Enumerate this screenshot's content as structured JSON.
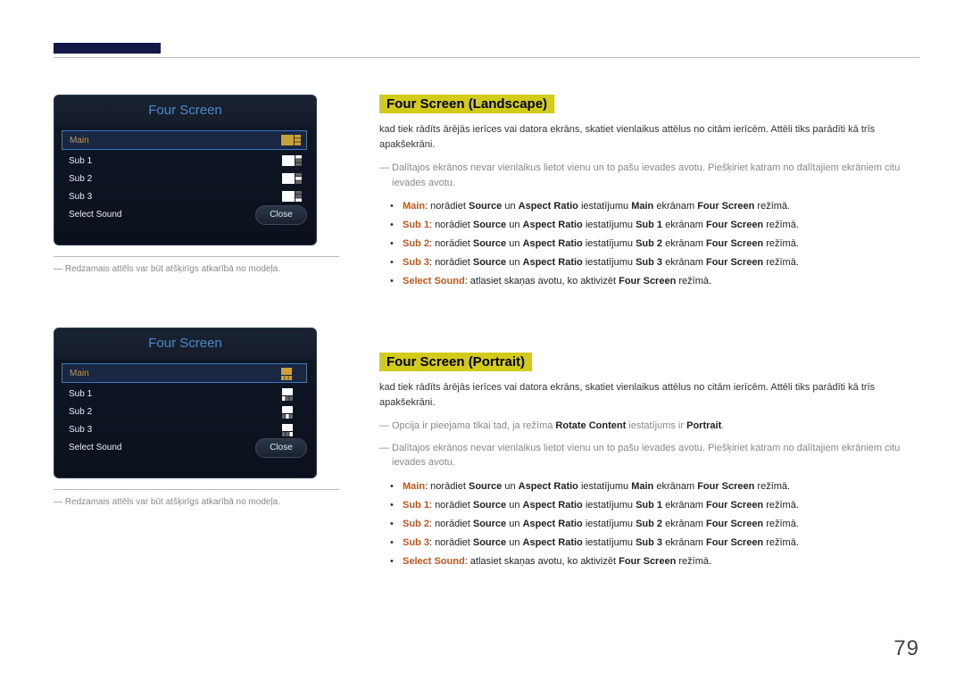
{
  "page_number": "79",
  "osd": {
    "title": "Four Screen",
    "rows": [
      "Main",
      "Sub 1",
      "Sub 2",
      "Sub 3",
      "Select Sound"
    ],
    "close": "Close"
  },
  "caption": "Redzamais attēls var būt atšķirīgs atkarībā no modeļa.",
  "landscape": {
    "title": "Four Screen (Landscape)",
    "lead": "kad tiek rādīts ārējās ierīces vai datora ekrāns, skatiet vienlaikus attēlus no citām ierīcēm. Attēli tiks parādīti kā trīs apakšekrāni.",
    "note1_prefix": "Dalītajos ekrānos nevar vienlaikus lietot vienu un to pašu ievades avotu. Piešķiriet katram no dalītajiem ekrāniem citu ievades avotu.",
    "items": [
      {
        "k": "Main",
        "mid": ": norādiet ",
        "a": "Source",
        "un": " un ",
        "b": "Aspect Ratio",
        "t1": " iestatījumu ",
        "c": "Main",
        "t2": " ekrānam ",
        "d": "Four Screen",
        "t3": " režīmā."
      },
      {
        "k": "Sub 1",
        "mid": ": norādiet ",
        "a": "Source",
        "un": " un ",
        "b": "Aspect Ratio",
        "t1": " iestatījumu ",
        "c": "Sub 1",
        "t2": " ekrānam ",
        "d": "Four Screen",
        "t3": " režīmā."
      },
      {
        "k": "Sub 2",
        "mid": ": norādiet ",
        "a": "Source",
        "un": " un ",
        "b": "Aspect Ratio",
        "t1": " iestatījumu ",
        "c": "Sub 2",
        "t2": " ekrānam ",
        "d": "Four Screen",
        "t3": " režīmā."
      },
      {
        "k": "Sub 3",
        "mid": ": norādiet ",
        "a": "Source",
        "un": " un ",
        "b": "Aspect Ratio",
        "t1": " iestatījumu ",
        "c": "Sub 3",
        "t2": " ekrānam ",
        "d": "Four Screen",
        "t3": " režīmā."
      },
      {
        "k": "Select Sound",
        "mid": ": atlasiet skaņas avotu, ko aktivizēt ",
        "a": "Four Screen",
        "t3": " režīmā."
      }
    ]
  },
  "portrait": {
    "title": "Four Screen (Portrait)",
    "lead": "kad tiek rādīts ārējās ierīces vai datora ekrāns, skatiet vienlaikus attēlus no citām ierīcēm. Attēli tiks parādīti kā trīs apakšekrāni.",
    "note0_a": "Opcija ir pieejama tikai tad, ja režīma ",
    "note0_b": "Rotate Content",
    "note0_c": " iestatījums ir ",
    "note0_d": "Portrait",
    "note0_e": ".",
    "note1_prefix": "Dalītajos ekrānos nevar vienlaikus lietot vienu un to pašu ievades avotu. Piešķiriet katram no dalītajiem ekrāniem citu ievades avotu.",
    "items": [
      {
        "k": "Main",
        "mid": ": norādiet ",
        "a": "Source",
        "un": " un ",
        "b": "Aspect Ratio",
        "t1": " iestatījumu ",
        "c": "Main",
        "t2": " ekrānam ",
        "d": "Four Screen",
        "t3": " režīmā."
      },
      {
        "k": "Sub 1",
        "mid": ": norādiet ",
        "a": "Source",
        "un": " un ",
        "b": "Aspect Ratio",
        "t1": " iestatījumu ",
        "c": "Sub 1",
        "t2": " ekrānam ",
        "d": "Four Screen",
        "t3": " režīmā."
      },
      {
        "k": "Sub 2",
        "mid": ": norādiet ",
        "a": "Source",
        "un": " un ",
        "b": "Aspect Ratio",
        "t1": " iestatījumu ",
        "c": "Sub 2",
        "t2": " ekrānam ",
        "d": "Four Screen",
        "t3": " režīmā."
      },
      {
        "k": "Sub 3",
        "mid": ": norādiet ",
        "a": "Source",
        "un": " un ",
        "b": "Aspect Ratio",
        "t1": " iestatījumu ",
        "c": "Sub 3",
        "t2": " ekrānam ",
        "d": "Four Screen",
        "t3": " režīmā."
      },
      {
        "k": "Select Sound",
        "mid": ": atlasiet skaņas avotu, ko aktivizēt ",
        "a": "Four Screen",
        "t3": " režīmā."
      }
    ]
  }
}
